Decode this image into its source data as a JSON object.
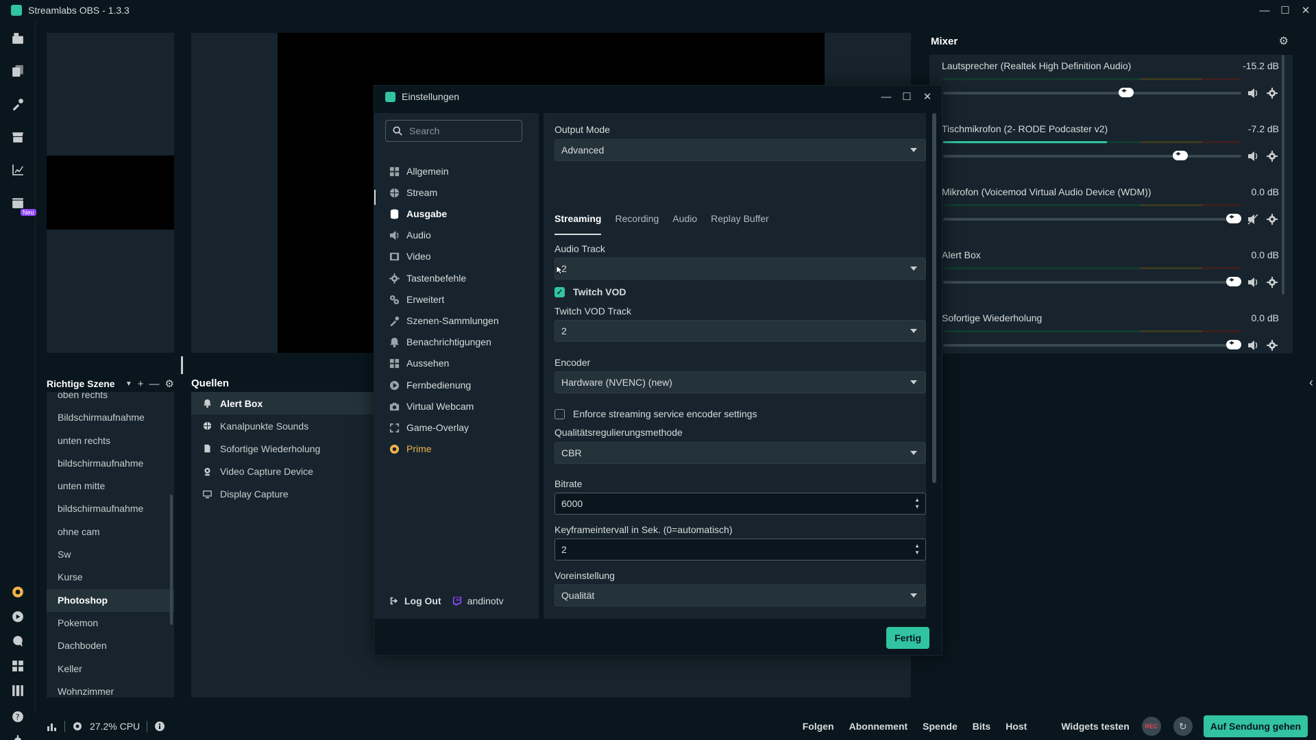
{
  "window": {
    "title": "Streamlabs OBS - 1.3.3"
  },
  "nav": {
    "badge": "Neu"
  },
  "scenes": {
    "title": "Richtige Szene",
    "items": [
      "oben rechts",
      "Bildschirmaufnahme",
      "unten rechts",
      "bildschirmaufnahme",
      "unten mitte",
      "bildschirmaufnahme",
      "ohne cam",
      "Sw",
      "Kurse",
      "Photoshop",
      "Pokemon",
      "Dachboden",
      "Keller",
      "Wohnzimmer"
    ],
    "active": "Photoshop"
  },
  "sources": {
    "title": "Quellen",
    "items": [
      {
        "label": "Alert Box",
        "icon": "bell-icon",
        "active": true
      },
      {
        "label": "Kanalpunkte Sounds",
        "icon": "globe-icon",
        "active": false
      },
      {
        "label": "Sofortige Wiederholung",
        "icon": "file-icon",
        "active": false
      },
      {
        "label": "Video Capture Device",
        "icon": "webcam-icon",
        "active": false
      },
      {
        "label": "Display Capture",
        "icon": "monitor-icon",
        "active": false
      }
    ]
  },
  "mixer": {
    "title": "Mixer",
    "items": [
      {
        "name": "Lautsprecher (Realtek High Definition Audio)",
        "db": "-15.2 dB",
        "level": 0.0,
        "volume": 0.62,
        "muted": false
      },
      {
        "name": "Tischmikrofon (2- RODE Podcaster v2)",
        "db": "-7.2 dB",
        "level": 0.55,
        "volume": 0.81,
        "muted": false
      },
      {
        "name": "Mikrofon (Voicemod Virtual Audio Device (WDM))",
        "db": "0.0 dB",
        "level": 0.0,
        "volume": 1.0,
        "muted": true
      },
      {
        "name": "Alert Box",
        "db": "0.0 dB",
        "level": 0.0,
        "volume": 1.0,
        "muted": false
      },
      {
        "name": "Sofortige Wiederholung",
        "db": "0.0 dB",
        "level": 0.0,
        "volume": 1.0,
        "muted": false
      }
    ]
  },
  "footer": {
    "cpu": "27.2% CPU",
    "links": [
      "Folgen",
      "Abonnement",
      "Spende",
      "Bits",
      "Host"
    ],
    "widgets": "Widgets testen",
    "rec": "REC",
    "golive": "Auf Sendung gehen"
  },
  "settings": {
    "title": "Einstellungen",
    "search_placeholder": "Search",
    "menu": [
      {
        "label": "Allgemein",
        "icon": "grid-icon"
      },
      {
        "label": "Stream",
        "icon": "globe-icon"
      },
      {
        "label": "Ausgabe",
        "icon": "database-icon",
        "active": true
      },
      {
        "label": "Audio",
        "icon": "speaker-icon"
      },
      {
        "label": "Video",
        "icon": "film-icon"
      },
      {
        "label": "Tastenbefehle",
        "icon": "gear-icon"
      },
      {
        "label": "Erweitert",
        "icon": "gears-icon"
      },
      {
        "label": "Szenen-Sammlungen",
        "icon": "tools-icon"
      },
      {
        "label": "Benachrichtigungen",
        "icon": "bell-icon"
      },
      {
        "label": "Aussehen",
        "icon": "grid-icon"
      },
      {
        "label": "Fernbedienung",
        "icon": "play-icon"
      },
      {
        "label": "Virtual Webcam",
        "icon": "camera-icon"
      },
      {
        "label": "Game-Overlay",
        "icon": "expand-icon"
      },
      {
        "label": "Prime",
        "icon": "prime-icon",
        "prime": true
      }
    ],
    "logout": "Log Out",
    "username": "andinotv",
    "output_mode_label": "Output Mode",
    "output_mode": "Advanced",
    "tabs": [
      "Streaming",
      "Recording",
      "Audio",
      "Replay Buffer"
    ],
    "active_tab": "Streaming",
    "audio_track_label": "Audio Track",
    "audio_track": "2",
    "twitch_vod_label": "Twitch VOD",
    "twitch_vod_checked": true,
    "twitch_vod_track_label": "Twitch VOD Track",
    "twitch_vod_track": "2",
    "encoder_label": "Encoder",
    "encoder": "Hardware (NVENC) (new)",
    "enforce_label": "Enforce streaming service encoder settings",
    "enforce_checked": false,
    "rate_control_label": "Qualitätsregulierungsmethode",
    "rate_control": "CBR",
    "bitrate_label": "Bitrate",
    "bitrate": "6000",
    "keyframe_label": "Keyframeintervall in Sek. (0=automatisch)",
    "keyframe": "2",
    "preset_label": "Voreinstellung",
    "preset": "Qualität",
    "done": "Fertig"
  },
  "colors": {
    "accent": "#31c3a2",
    "bg": "#09161d",
    "panel": "#17242d",
    "prime": "#f0b24a",
    "twitch": "#9146ff"
  }
}
